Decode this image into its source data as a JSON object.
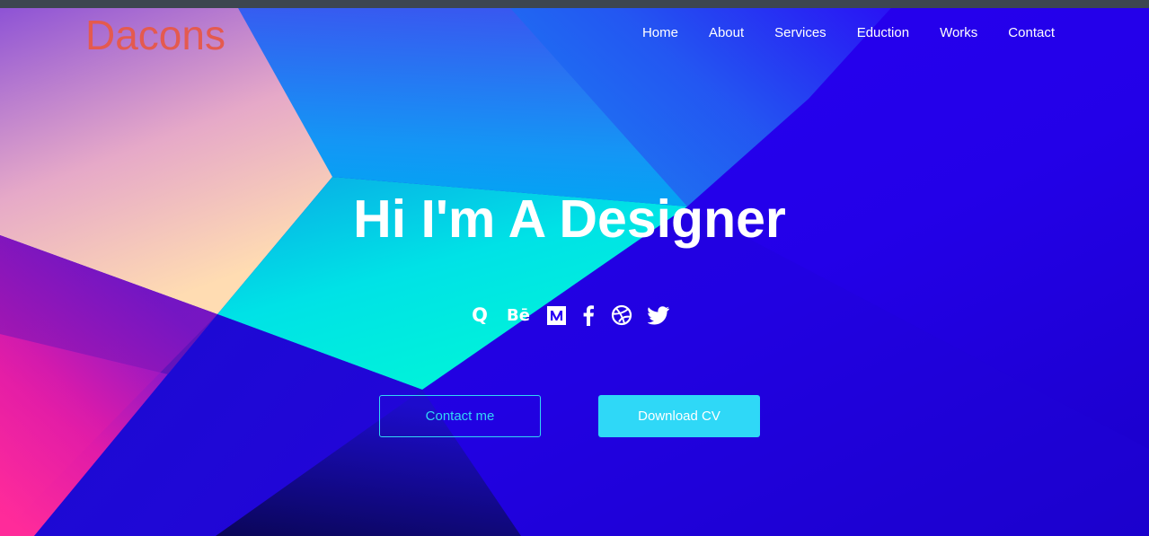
{
  "brand": {
    "logo_text": "Dacons"
  },
  "nav": {
    "items": [
      "Home",
      "About",
      "Services",
      "Eduction",
      "Works",
      "Contact"
    ]
  },
  "hero": {
    "title": "Hi I'm A Designer",
    "social_icons": [
      "quora-icon",
      "behance-icon",
      "medium-icon",
      "facebook-icon",
      "dribbble-icon",
      "twitter-icon"
    ],
    "social_glyphs": {
      "quora": "Q",
      "behance": "Bē"
    },
    "contact_button": "Contact me",
    "download_button": "Download CV"
  },
  "colors": {
    "background": "#2a00f5",
    "logo": "#e45a4f",
    "accent": "#2fd8f7",
    "text": "#ffffff"
  }
}
